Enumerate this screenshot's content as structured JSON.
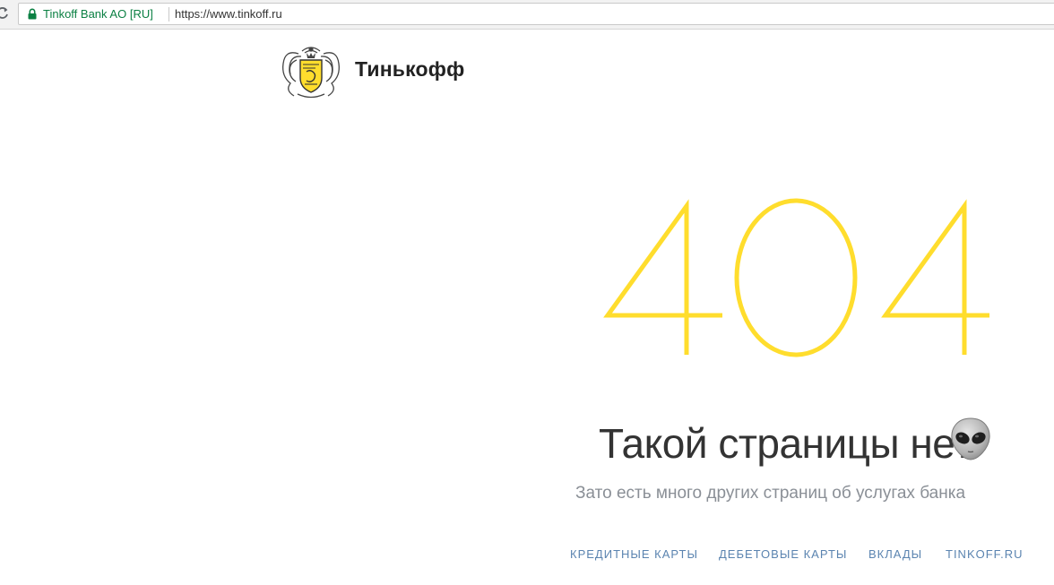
{
  "browser": {
    "cert_name": "Tinkoff Bank AO [RU]",
    "url": "https://www.tinkoff.ru",
    "secure_icon": "lock-icon",
    "reload_icon": "reload-icon"
  },
  "header": {
    "logo_text": "Тинькофф",
    "logo_icon": "tinkoff-emblem-icon"
  },
  "error": {
    "code": "404",
    "title": "Такой страницы нет",
    "title_icon": "alien-emoji-icon",
    "subtitle": "Зато есть много других страниц об услугах банка"
  },
  "footer": {
    "links": [
      {
        "label": "КРЕДИТНЫЕ КАРТЫ"
      },
      {
        "label": "ДЕБЕТОВЫЕ КАРТЫ"
      },
      {
        "label": "ВКЛАДЫ"
      },
      {
        "label": "TINKOFF.RU"
      }
    ]
  },
  "colors": {
    "accent_yellow": "#FFDD2D",
    "link_blue": "#5B84B0",
    "secure_green": "#0B8043",
    "title_text": "#333333",
    "subtitle_text": "#8A8F96"
  }
}
